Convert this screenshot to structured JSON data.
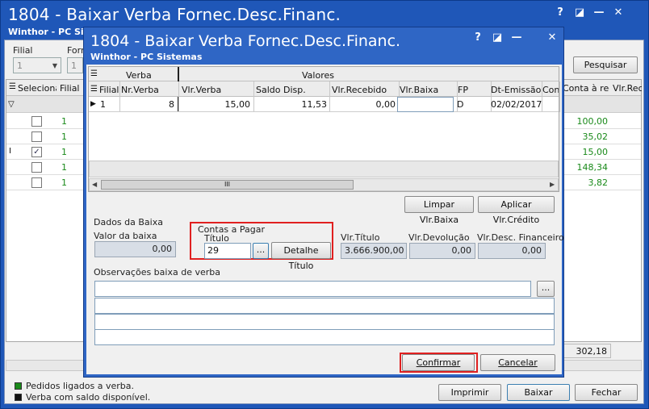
{
  "background": {
    "title": "1804 - Baixar Verba Fornec.Desc.Financ.",
    "subtitle": "Winthor - PC Sistemas",
    "filter": {
      "filial_label": "Filial",
      "filial_value": "1",
      "forn_label": "Forn",
      "forn_value": "1"
    },
    "search_button": "Pesquisar",
    "columns": {
      "selecionar": "Selecionar",
      "filial": "Filial",
      "a_receber": "Conta à receber",
      "vlr_rec": "Vlr.Rece"
    },
    "rows": [
      {
        "checked": false,
        "filial": "1",
        "valor": "100,00"
      },
      {
        "checked": false,
        "filial": "1",
        "valor": "35,02"
      },
      {
        "checked": true,
        "filial": "1",
        "valor": "15,00"
      },
      {
        "checked": false,
        "filial": "1",
        "valor": "148,34"
      },
      {
        "checked": false,
        "filial": "1",
        "valor": "3,82"
      }
    ],
    "total": "302,18",
    "legend": [
      "Pedidos ligados a verba.",
      "Verba com saldo disponível."
    ],
    "legend_colors": [
      "#1a8a1a",
      "#111111"
    ],
    "buttons": {
      "imprimir": "Imprimir",
      "baixar": "Baixar",
      "fechar": "Fechar"
    }
  },
  "dialog": {
    "title": "1804 - Baixar Verba Fornec.Desc.Financ.",
    "subtitle": "Winthor - PC Sistemas",
    "group_headers": {
      "verba": "Verba",
      "valores": "Valores"
    },
    "columns": [
      "Filial",
      "Nr.Verba",
      "Vlr.Verba",
      "Saldo Disp.",
      "Vlr.Recebido",
      "Vlr.Baixa",
      "FP",
      "Dt-Emissão",
      "Conta"
    ],
    "row": {
      "filial": "1",
      "nr_verba": "8",
      "vlr_verba": "15,00",
      "saldo": "11,53",
      "recebido": "0,00",
      "baixa": "",
      "fp": "D",
      "emissao": "02/02/2017"
    },
    "scroll_thumb": "III",
    "limpar_button": "Limpar Vlr.Baixa",
    "aplicar_button": "Aplicar Vlr.Crédito",
    "dados_baixa": "Dados da Baixa",
    "valor_baixa_label": "Valor da baixa",
    "valor_baixa": "0,00",
    "contas_pagar": "Contas a Pagar",
    "titulo_label": "Título",
    "titulo_value": "29",
    "ellipsis": "...",
    "detalhe_button": "Detalhe Título",
    "vlr_titulo_label": "Vlr.Título",
    "vlr_titulo": "3.666.900,00",
    "vlr_devolucao_label": "Vlr.Devolução",
    "vlr_devolucao": "0,00",
    "vlr_desc_label": "Vlr.Desc. Financeiro",
    "vlr_desc": "0,00",
    "obs_label": "Observações baixa de verba",
    "confirmar": "Confirmar",
    "cancelar": "Cancelar"
  },
  "window_controls": {
    "help": "?",
    "edit": "◪",
    "minimize": "—",
    "close": "✕"
  }
}
